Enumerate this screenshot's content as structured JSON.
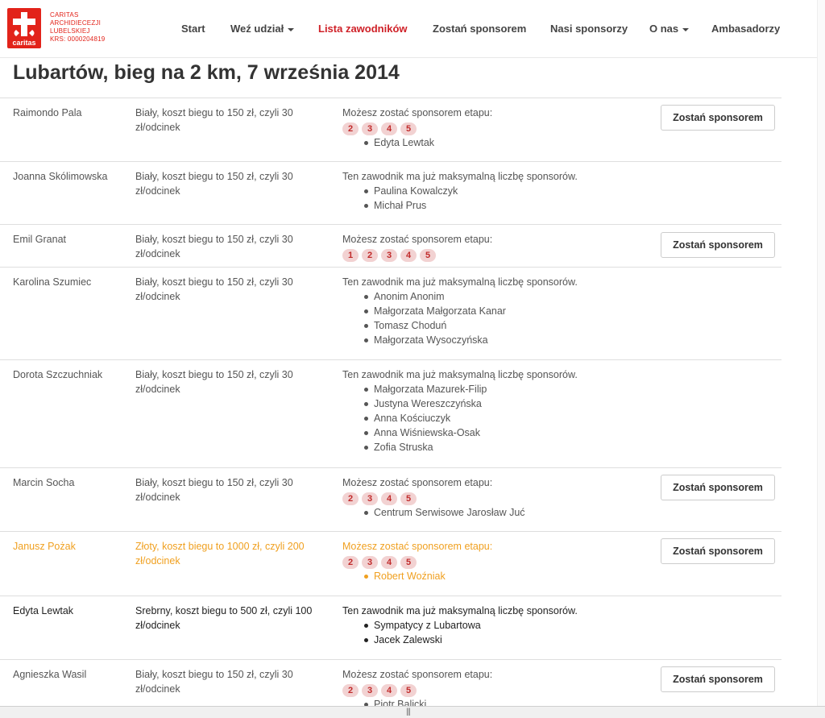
{
  "brand": {
    "logo_word": "caritas",
    "lines": [
      "CARITAS",
      "ARCHIDIECEZJI",
      "LUBELSKIEJ",
      "KRS: 0000204819"
    ]
  },
  "nav": [
    {
      "label": "Start",
      "dropdown": false,
      "active": false
    },
    {
      "label": "Weź udział",
      "dropdown": true,
      "active": false
    },
    {
      "label": "Lista zawodników",
      "dropdown": false,
      "active": true
    },
    {
      "label": "Zostań sponsorem",
      "dropdown": false,
      "active": false
    },
    {
      "label": "Nasi sponsorzy",
      "dropdown": false,
      "active": false
    },
    {
      "label": "O nas",
      "dropdown": true,
      "active": false
    },
    {
      "label": "Ambasadorzy",
      "dropdown": false,
      "active": false
    }
  ],
  "page_title": "Lubartów, bieg na 2 km, 7 września 2014",
  "button_label": "Zostań sponsorem",
  "runners": [
    {
      "name": "Raimondo Pala",
      "desc": "Biały, koszt biegu to 150 zł, czyli 30 zł/odcinek",
      "status": "Możesz zostać sponsorem etapu:",
      "stages": [
        "2",
        "3",
        "4",
        "5"
      ],
      "sponsors": [
        "Edyta Lewtak"
      ],
      "button": true,
      "tier": "white"
    },
    {
      "name": "Joanna Skólimowska",
      "desc": "Biały, koszt biegu to 150 zł, czyli 30 zł/odcinek",
      "status": "Ten zawodnik ma już maksymalną liczbę sponsorów.",
      "stages": [],
      "sponsors": [
        "Paulina Kowalczyk",
        "Michał Prus"
      ],
      "button": false,
      "tier": "white"
    },
    {
      "name": "Emil Granat",
      "desc": "Biały, koszt biegu to 150 zł, czyli 30 zł/odcinek",
      "status": "Możesz zostać sponsorem etapu:",
      "stages": [
        "1",
        "2",
        "3",
        "4",
        "5"
      ],
      "sponsors": [],
      "button": true,
      "tier": "white"
    },
    {
      "name": "Karolina Szumiec",
      "desc": "Biały, koszt biegu to 150 zł, czyli 30 zł/odcinek",
      "status": "Ten zawodnik ma już maksymalną liczbę sponsorów.",
      "stages": [],
      "sponsors": [
        "Anonim Anonim",
        "Małgorzata Małgorzata Kanar",
        "Tomasz Choduń",
        "Małgorzata Wysoczyńska"
      ],
      "button": false,
      "tier": "white"
    },
    {
      "name": "Dorota Szczuchniak",
      "desc": "Biały, koszt biegu to 150 zł, czyli 30 zł/odcinek",
      "status": "Ten zawodnik ma już maksymalną liczbę sponsorów.",
      "stages": [],
      "sponsors": [
        "Małgorzata Mazurek-Filip",
        "Justyna Wereszczyńska",
        "Anna Kościuczyk",
        "Anna Wiśniewska-Osak",
        "Zofia Struska"
      ],
      "button": false,
      "tier": "white"
    },
    {
      "name": "Marcin Socha",
      "desc": "Biały, koszt biegu to 150 zł, czyli 30 zł/odcinek",
      "status": "Możesz zostać sponsorem etapu:",
      "stages": [
        "2",
        "3",
        "4",
        "5"
      ],
      "sponsors": [
        "Centrum Serwisowe Jarosław Juć"
      ],
      "button": true,
      "tier": "white"
    },
    {
      "name": "Janusz Pożak",
      "desc": "Złoty, koszt biegu to 1000 zł, czyli 200 zł/odcinek",
      "status": "Możesz zostać sponsorem etapu:",
      "stages": [
        "2",
        "3",
        "4",
        "5"
      ],
      "sponsors": [
        "Robert Woźniak"
      ],
      "button": true,
      "tier": "gold"
    },
    {
      "name": "Edyta Lewtak",
      "desc": "Srebrny, koszt biegu to 500 zł, czyli 100 zł/odcinek",
      "status": "Ten zawodnik ma już maksymalną liczbę sponsorów.",
      "stages": [],
      "sponsors": [
        "Sympatycy z Lubartowa",
        "Jacek Zalewski"
      ],
      "button": false,
      "tier": "silver"
    },
    {
      "name": "Agnieszka Wasil",
      "desc": "Biały, koszt biegu to 150 zł, czyli 30 zł/odcinek",
      "status": "Możesz zostać sponsorem etapu:",
      "stages": [
        "2",
        "3",
        "4",
        "5"
      ],
      "sponsors": [
        "Piotr Balicki"
      ],
      "button": true,
      "tier": "white"
    }
  ],
  "colors": {
    "brand_red": "#cf2027",
    "gold": "#f0a020",
    "stage_bg": "#f2d2d2"
  }
}
